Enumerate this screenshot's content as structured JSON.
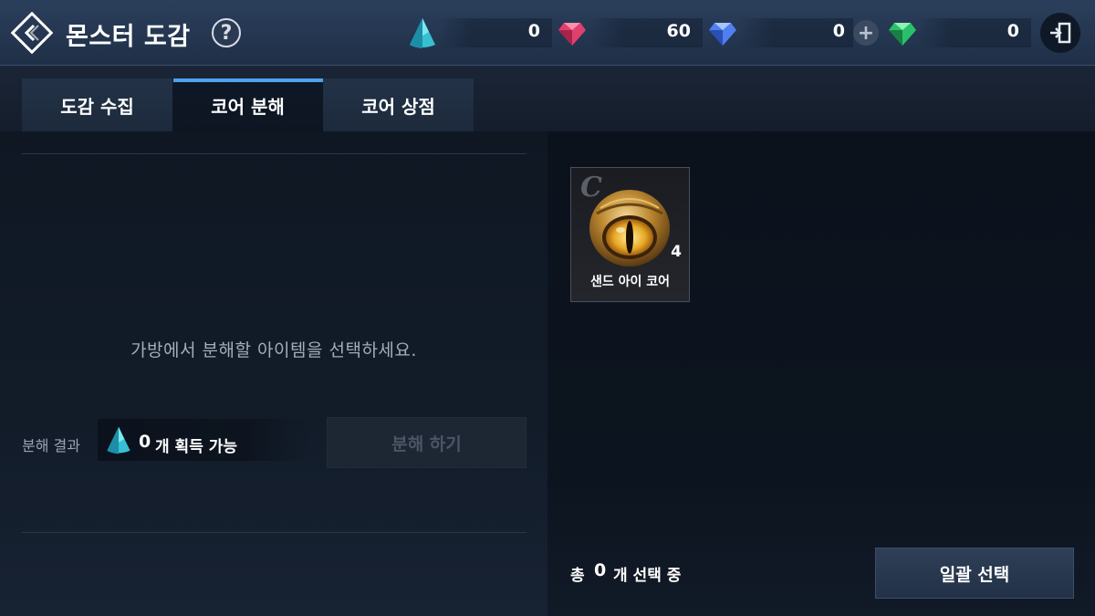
{
  "header": {
    "title": "몬스터 도감",
    "help_label": "?",
    "currencies": [
      {
        "name": "core-essence",
        "value": "0",
        "color": "#2fb3c9"
      },
      {
        "name": "red-gem",
        "value": "60",
        "color": "#e0406e"
      },
      {
        "name": "blue-gem",
        "value": "0",
        "color": "#4f7ff0"
      },
      {
        "name": "green-gem",
        "value": "0",
        "color": "#29c06a"
      }
    ],
    "plus_label": "+"
  },
  "tabs": [
    {
      "label": "도감 수집",
      "active": false
    },
    {
      "label": "코어 분해",
      "active": true
    },
    {
      "label": "코어 상점",
      "active": false
    }
  ],
  "left": {
    "empty_message": "가방에서 분해할 아이템을 선택하세요.",
    "result_label": "분해 결과",
    "result_count": "0",
    "result_text": "개 획득 가능",
    "decompose_button": "분해 하기"
  },
  "inventory": {
    "items": [
      {
        "grade": "C",
        "name": "샌드 아이 코어",
        "quantity": "4"
      }
    ],
    "selected_prefix": "총",
    "selected_count": "0",
    "selected_suffix": "개 선택 중",
    "bulk_select_button": "일괄 선택"
  },
  "colors": {
    "accent": "#4ea2f0",
    "background": "#0c1420"
  }
}
